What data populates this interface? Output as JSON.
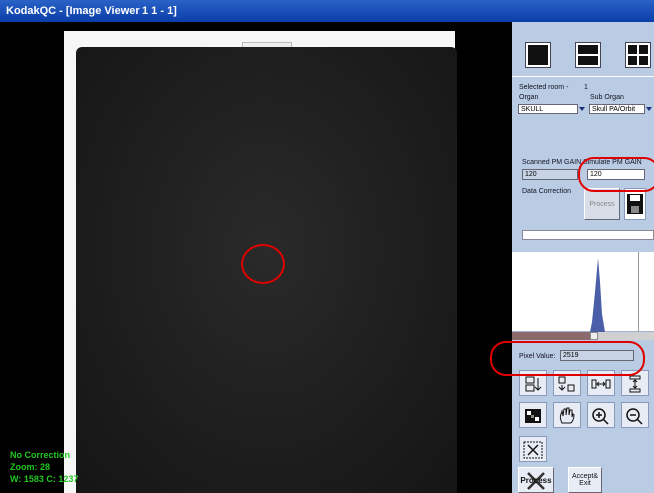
{
  "window": {
    "title": "KodakQC - [Image Viewer",
    "frame_info": "1 1 - 1]"
  },
  "overlay": {
    "correction": "No Correction",
    "zoom": "Zoom: 28",
    "window_center": "W: 1583  C: 1237"
  },
  "panel": {
    "selected_room_label": "Selected room -",
    "selected_room_value": "1",
    "organ_label": "Organ",
    "organ_value": "SKULL",
    "sub_organ_label": "Sub Organ",
    "sub_organ_value": "Skull PA/Orbit",
    "scanned_gain_label": "Scanned PM GAIN",
    "scanned_gain_value": "120",
    "simulate_gain_label": "Simulate PM GAIN",
    "simulate_gain_value": "120",
    "data_correction_label": "Data Correction",
    "process_label": "Process",
    "pixel_value_label": "Pixel Value:",
    "pixel_value": "2519",
    "process_button_label": "Process",
    "accept_exit_label": "Accept& Exit"
  },
  "icons": {
    "layout1": "single-view-layout-icon",
    "layout2": "split-view-layout-icon",
    "layout4": "quad-view-layout-icon",
    "save": "floppy-disk-icon",
    "hand": "hand-pan-icon",
    "zoom_in": "zoom-in-icon",
    "zoom_out": "zoom-out-icon",
    "scissors": "scissors-icon"
  },
  "colors": {
    "title_bar": "#0a3ea8",
    "panel": "#b9cce4",
    "overlay_text": "#21c721",
    "highlight_circle": "#e00000"
  },
  "histogram": {
    "scroll_position": 0.6
  }
}
